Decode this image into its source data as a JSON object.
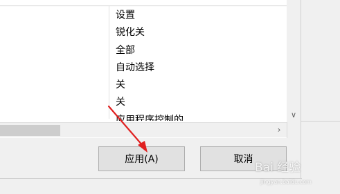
{
  "settings_list": {
    "items": [
      "设置",
      "锐化关",
      "全部",
      "自动选择",
      "关",
      "关",
      "应用程序控制的"
    ]
  },
  "scrollbars": {
    "down_arrow_icon": "chevron-down-icon",
    "right_arrow_icon": "chevron-right-icon"
  },
  "buttons": {
    "apply_label": "应用(A)",
    "cancel_label": "取消"
  },
  "annotation": {
    "arrow_color": "#e02020"
  },
  "watermark": {
    "text": "Bai 经验",
    "subtext": "jingyan.baidu.com"
  }
}
